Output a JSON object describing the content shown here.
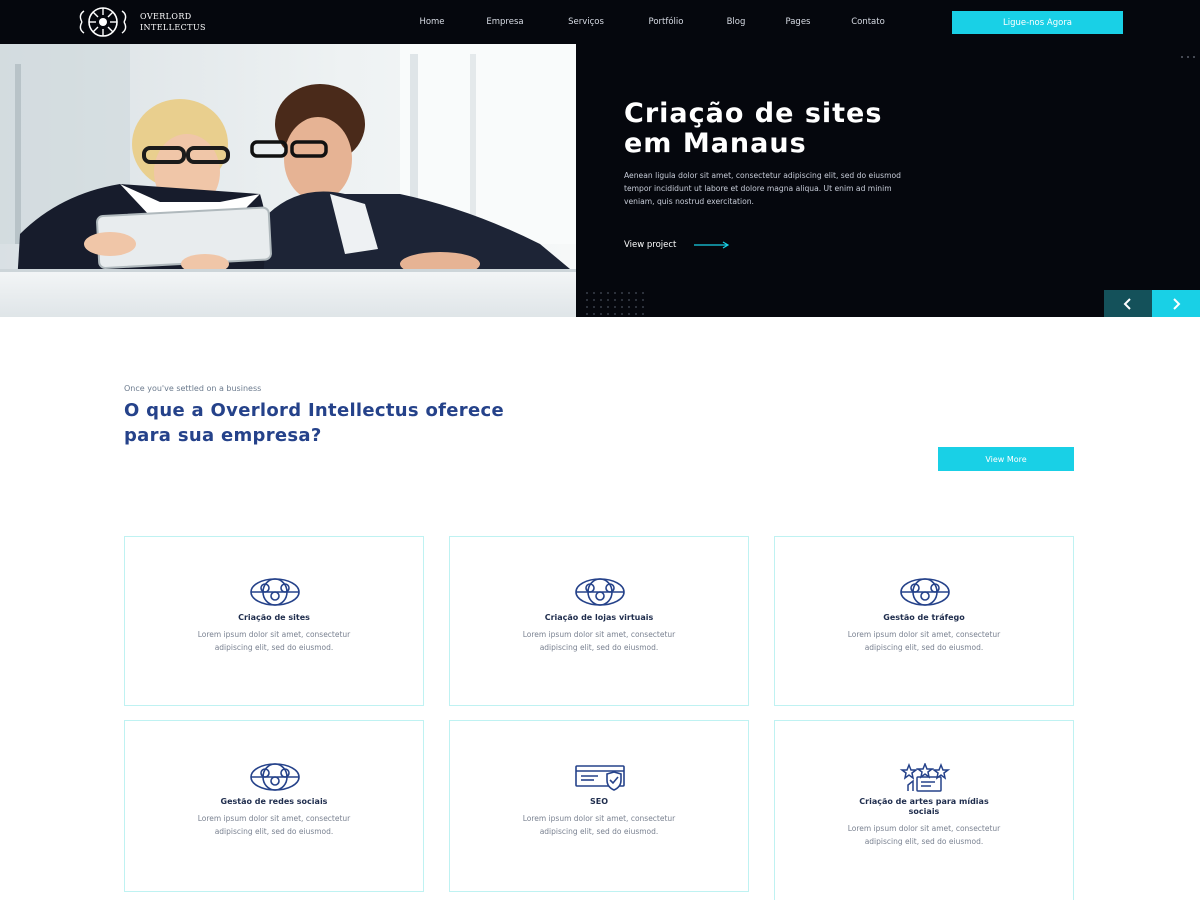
{
  "brand": {
    "name_line1": "OVERLORD",
    "name_line2": "INTELLECTUS"
  },
  "nav": {
    "items": [
      "Home",
      "Empresa",
      "Serviços",
      "Portfólio",
      "Blog",
      "Pages",
      "Contato"
    ],
    "cta": "Ligue-nos Agora"
  },
  "hero": {
    "title_line1": "Criação de sites",
    "title_line2": "em Manaus",
    "text": "Aenean ligula dolor sit amet, consectetur adipiscing elit, sed do eiusmod tempor incididunt ut labore et dolore magna aliqua. Ut enim ad minim veniam, quis nostrud exercitation.",
    "link": "View project",
    "prev_icon": "chevron-left-icon",
    "next_icon": "chevron-right-icon"
  },
  "services": {
    "eyebrow": "Once you've settled on a business",
    "title": "O que a Overlord Intellectus oferece para sua empresa?",
    "view_more": "View More",
    "cards": [
      {
        "title": "Criação de sites",
        "desc": "Lorem ipsum dolor sit amet, consectetur adipiscing elit, sed do eiusmod.",
        "icon": "globe-team-icon"
      },
      {
        "title": "Criação de lojas virtuais",
        "desc": "Lorem ipsum dolor sit amet, consectetur adipiscing elit, sed do eiusmod.",
        "icon": "globe-team-icon"
      },
      {
        "title": "Gestão de tráfego",
        "desc": "Lorem ipsum dolor sit amet, consectetur adipiscing elit, sed do eiusmod.",
        "icon": "globe-team-icon"
      },
      {
        "title": "Gestão de redes sociais",
        "desc": "Lorem ipsum dolor sit amet, consectetur adipiscing elit, sed do eiusmod.",
        "icon": "globe-team-icon"
      },
      {
        "title": "SEO",
        "desc": "Lorem ipsum dolor sit amet, consectetur adipiscing elit, sed do eiusmod.",
        "icon": "seo-shield-icon"
      },
      {
        "title": "Criação de artes para mídias sociais",
        "desc": "Lorem ipsum dolor sit amet, consectetur adipiscing elit, sed do eiusmod.",
        "icon": "star-rating-icon"
      }
    ]
  },
  "colors": {
    "accent": "#19d0e6",
    "dark": "#05070d",
    "heading": "#25428a"
  }
}
